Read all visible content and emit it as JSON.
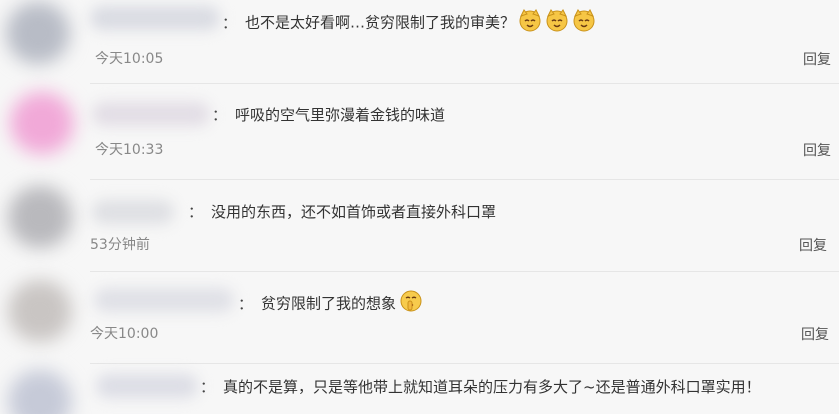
{
  "comments": [
    {
      "text": "也不是太好看啊…贫穷限制了我的审美？",
      "emojis": [
        "cat-face-emoji",
        "cat-face-emoji",
        "cat-face-emoji"
      ],
      "time": "今天10:05",
      "reply": "回复",
      "avatar_color": "#b8bcc6"
    },
    {
      "text": "呼吸的空气里弥漫着金钱的味道",
      "emojis": [],
      "time": "今天10:33",
      "reply": "回复",
      "avatar_color": "#f1a9d8"
    },
    {
      "text": "没用的东西，还不如首饰或者直接外科口罩",
      "emojis": [],
      "time": "53分钟前",
      "reply": "回复",
      "avatar_color": "#b9b9bd"
    },
    {
      "text": "贫穷限制了我的想象",
      "emojis": [
        "shushing-face-emoji"
      ],
      "time": "今天10:00",
      "reply": "回复",
      "avatar_color": "#c9c5c3"
    },
    {
      "text": "真的不是算，只是等他带上就知道耳朵的压力有多大了~还是普通外科口罩实用！",
      "emojis": [],
      "time": "",
      "reply": "",
      "avatar_color": "#c6cad8"
    }
  ],
  "separator": "："
}
